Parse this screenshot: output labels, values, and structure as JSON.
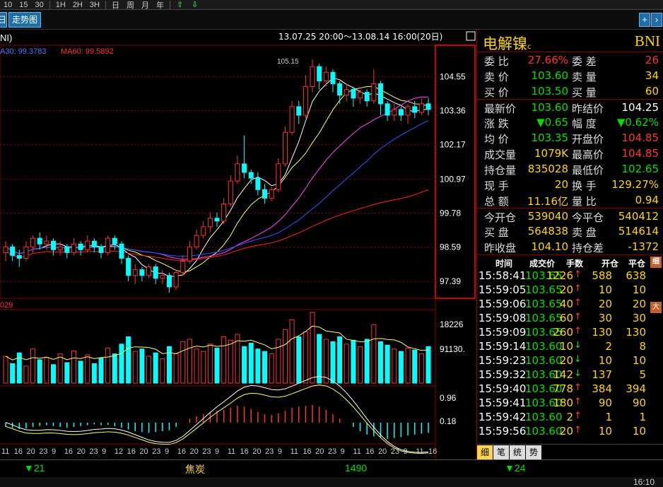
{
  "toolbar": {
    "periods": [
      "10",
      "15",
      "30",
      "1H",
      "2H",
      "3H",
      "日",
      "周",
      "月",
      "年"
    ],
    "up_arrow": "⇧",
    "down_arrow": "⇩"
  },
  "tabs": {
    "left_partial": "日",
    "trend": "走势图",
    "plus": "+",
    "right": "›"
  },
  "chart": {
    "code_tag": "NI)",
    "date_range": "13.07.25 20:00～13.08.14 16:00(20日)",
    "ma30_label": "A30: 99.3783",
    "ma60_label": "MA60: 99.5892",
    "peak_label": "105.15",
    "price_ticks": [
      "104.55",
      "103.36",
      "102.17",
      "100.97",
      "99.78",
      "98.59",
      "97.39"
    ],
    "vol_label": "029",
    "vol_ticks": [
      "18226",
      "91130."
    ],
    "macd_ticks": [
      "0.96",
      "0.18"
    ],
    "x_labels": [
      "11",
      "16",
      "20",
      "23",
      "9",
      "16",
      "20",
      "23",
      "9",
      "12",
      "16",
      "20",
      "23",
      "9",
      "16",
      "20",
      "23",
      "9",
      "11",
      "16",
      "20",
      "23",
      "9",
      "11",
      "16",
      "20",
      "23",
      "9",
      "11",
      "16",
      "20",
      "23",
      "9",
      "11",
      "16"
    ],
    "colors": {
      "up": "#ff3232",
      "down": "#00ffff",
      "ma5": "#ffffff",
      "ma10": "#ffff66",
      "ma20": "#ff44ff",
      "ma30": "#3355ff",
      "ma60": "#ff2222"
    }
  },
  "chart_data": {
    "type": "candlestick",
    "title": "",
    "ylim": [
      97.0,
      105.3
    ],
    "y_ticks": [
      104.55,
      103.36,
      102.17,
      100.97,
      99.78,
      98.59,
      97.39
    ],
    "peak_marker": 105.15,
    "series": [
      {
        "name": "MA30",
        "last": 99.3783
      },
      {
        "name": "MA60",
        "last": 99.5892
      }
    ],
    "candles": [
      [
        98.4,
        98.6,
        98.1,
        98.8
      ],
      [
        98.6,
        98.3,
        98.1,
        98.7
      ],
      [
        98.3,
        98.2,
        97.9,
        98.5
      ],
      [
        98.2,
        98.6,
        98.1,
        98.8
      ],
      [
        98.6,
        98.9,
        98.4,
        99.0
      ],
      [
        98.9,
        98.7,
        98.5,
        99.1
      ],
      [
        98.7,
        98.8,
        98.5,
        99.0
      ],
      [
        98.8,
        98.5,
        98.3,
        98.9
      ],
      [
        98.5,
        98.6,
        98.3,
        98.8
      ],
      [
        98.6,
        98.4,
        98.2,
        98.7
      ],
      [
        98.4,
        98.7,
        98.3,
        98.9
      ],
      [
        98.7,
        98.5,
        98.3,
        98.8
      ],
      [
        98.5,
        98.8,
        98.4,
        99.0
      ],
      [
        98.8,
        98.6,
        98.4,
        98.9
      ],
      [
        98.6,
        98.4,
        98.2,
        98.7
      ],
      [
        98.4,
        98.9,
        98.3,
        99.0
      ],
      [
        98.9,
        98.7,
        98.5,
        99.0
      ],
      [
        98.7,
        98.2,
        98.0,
        98.8
      ],
      [
        98.2,
        97.6,
        97.4,
        98.3
      ],
      [
        97.6,
        97.8,
        97.3,
        98.0
      ],
      [
        97.8,
        97.6,
        97.4,
        97.9
      ],
      [
        97.6,
        97.9,
        97.5,
        98.0
      ],
      [
        97.9,
        97.5,
        97.3,
        98.0
      ],
      [
        97.5,
        97.6,
        97.3,
        97.8
      ],
      [
        97.6,
        97.2,
        97.0,
        97.7
      ],
      [
        97.2,
        97.7,
        97.1,
        97.8
      ],
      [
        97.7,
        98.1,
        97.6,
        98.3
      ],
      [
        98.1,
        98.6,
        98.0,
        98.8
      ],
      [
        98.6,
        99.0,
        98.5,
        99.2
      ],
      [
        99.0,
        99.3,
        98.9,
        99.5
      ],
      [
        99.3,
        99.6,
        99.1,
        99.8
      ],
      [
        99.6,
        99.5,
        99.3,
        99.8
      ],
      [
        99.5,
        100.1,
        99.4,
        100.3
      ],
      [
        100.1,
        100.9,
        100.0,
        101.1
      ],
      [
        100.9,
        101.5,
        100.8,
        101.8
      ],
      [
        101.5,
        101.2,
        101.0,
        102.5
      ],
      [
        101.2,
        101.0,
        100.8,
        101.3
      ],
      [
        101.0,
        100.6,
        100.4,
        101.2
      ],
      [
        100.6,
        100.3,
        100.1,
        100.8
      ],
      [
        100.3,
        100.6,
        100.2,
        100.7
      ],
      [
        100.6,
        101.5,
        100.5,
        101.7
      ],
      [
        101.5,
        102.6,
        101.4,
        102.8
      ],
      [
        102.6,
        103.5,
        102.5,
        103.7
      ],
      [
        103.5,
        103.2,
        102.9,
        103.7
      ],
      [
        103.2,
        104.2,
        103.1,
        104.6
      ],
      [
        104.2,
        104.9,
        104.0,
        105.15
      ],
      [
        104.9,
        104.4,
        104.1,
        105.0
      ],
      [
        104.4,
        104.7,
        104.2,
        104.9
      ],
      [
        104.7,
        104.3,
        104.0,
        104.8
      ],
      [
        104.3,
        103.9,
        103.6,
        104.4
      ],
      [
        103.9,
        104.1,
        103.7,
        104.3
      ],
      [
        104.1,
        103.8,
        103.5,
        104.2
      ],
      [
        103.8,
        104.0,
        103.6,
        104.1
      ],
      [
        104.0,
        103.7,
        103.5,
        104.1
      ],
      [
        103.7,
        104.3,
        103.6,
        104.8
      ],
      [
        104.3,
        103.6,
        103.2,
        104.4
      ],
      [
        103.6,
        103.2,
        103.0,
        103.7
      ],
      [
        103.2,
        103.4,
        103.0,
        103.6
      ],
      [
        103.4,
        103.2,
        103.0,
        103.5
      ],
      [
        103.2,
        103.5,
        102.9,
        103.6
      ],
      [
        103.5,
        103.3,
        103.1,
        103.7
      ],
      [
        103.3,
        103.6,
        103.2,
        103.8
      ],
      [
        103.6,
        103.4,
        103.2,
        103.8
      ]
    ],
    "volumes": [
      55,
      40,
      62,
      35,
      70,
      48,
      52,
      38,
      60,
      42,
      66,
      45,
      58,
      40,
      52,
      72,
      60,
      80,
      95,
      65,
      70,
      55,
      62,
      50,
      75,
      60,
      85,
      90,
      70,
      65,
      80,
      72,
      95,
      88,
      100,
      75,
      82,
      70,
      65,
      60,
      90,
      110,
      130,
      95,
      105,
      145,
      100,
      90,
      85,
      95,
      80,
      88,
      75,
      90,
      120,
      85,
      78,
      70,
      65,
      72,
      68,
      60,
      75
    ],
    "macd_hist": [
      -0.1,
      -0.12,
      -0.15,
      -0.14,
      -0.1,
      -0.08,
      -0.06,
      -0.08,
      -0.1,
      -0.12,
      -0.1,
      -0.08,
      -0.06,
      -0.04,
      -0.06,
      -0.05,
      -0.08,
      -0.12,
      -0.16,
      -0.2,
      -0.22,
      -0.24,
      -0.22,
      -0.2,
      -0.18,
      -0.1,
      0.0,
      0.1,
      0.15,
      0.2,
      0.25,
      0.28,
      0.3,
      0.35,
      0.4,
      0.38,
      0.32,
      0.25,
      0.2,
      0.18,
      0.22,
      0.28,
      0.35,
      0.38,
      0.4,
      0.42,
      0.38,
      0.3,
      0.2,
      0.1,
      0.0,
      -0.1,
      -0.2,
      -0.28,
      -0.32,
      -0.36,
      -0.38,
      -0.36,
      -0.34,
      -0.3,
      -0.28,
      -0.26,
      -0.24
    ]
  },
  "panel": {
    "name": "电解镍",
    "name_suffix": "c",
    "code": "BNI",
    "rows": [
      {
        "l1": "委  比",
        "v1": "27.66%",
        "c1": "r",
        "l2": "委  差",
        "v2": "26",
        "c2": "r"
      },
      {
        "l1": "卖  价",
        "v1": "103.60",
        "c1": "g",
        "l2": "卖  量",
        "v2": "34",
        "c2": "y"
      },
      {
        "l1": "买  价",
        "v1": "103.50",
        "c1": "g",
        "l2": "买  量",
        "v2": "60",
        "c2": "y"
      },
      {
        "l1": "最新价",
        "v1": "103.60",
        "c1": "g",
        "l2": "昨结价",
        "v2": "104.25",
        "c2": "w"
      },
      {
        "l1": "涨  跌",
        "v1": "▼0.65",
        "c1": "g",
        "l2": "幅  度",
        "v2": "▼0.62%",
        "c2": "g"
      },
      {
        "l1": "均  价",
        "v1": "103.35",
        "c1": "g",
        "l2": "开盘价",
        "v2": "104.85",
        "c2": "r"
      },
      {
        "l1": "成交量",
        "v1": "1079K",
        "c1": "y",
        "l2": "最高价",
        "v2": "104.85",
        "c2": "r"
      },
      {
        "l1": "持仓量",
        "v1": "835028",
        "c1": "y",
        "l2": "最低价",
        "v2": "102.65",
        "c2": "g"
      },
      {
        "l1": "现  手",
        "v1": "20",
        "c1": "y",
        "l2": "换  手",
        "v2": "129.27%",
        "c2": "y"
      },
      {
        "l1": "总  额",
        "v1": "11.16亿",
        "c1": "y",
        "l2": "量  比",
        "v2": "0.94",
        "c2": "y"
      },
      {
        "l1": "今开仓",
        "v1": "539040",
        "c1": "y",
        "l2": "今平仓",
        "v2": "540412",
        "c2": "y"
      },
      {
        "l1": "买  盘",
        "v1": "564838",
        "c1": "y",
        "l2": "卖  盘",
        "v2": "514614",
        "c2": "y"
      },
      {
        "l1": "昨收盘",
        "v1": "104.10",
        "c1": "y",
        "l2": "持仓差",
        "v2": "-1372",
        "c2": "y"
      }
    ],
    "ticks_header": {
      "time": "时间",
      "price": "成交价",
      "vol": "手数",
      "open": "开仓",
      "close": "平仓"
    },
    "ticks": [
      {
        "t": "15:58:41",
        "p": "103.65",
        "v": "1226",
        "a": "↑",
        "o": "588",
        "c": "638"
      },
      {
        "t": "15:59:05",
        "p": "103.65",
        "v": "20",
        "a": "↑",
        "o": "10",
        "c": "10"
      },
      {
        "t": "15:59:06",
        "p": "103.65",
        "v": "40",
        "a": "↑",
        "o": "20",
        "c": "20"
      },
      {
        "t": "15:59:08",
        "p": "103.65",
        "v": "60",
        "a": "↑",
        "o": "30",
        "c": "30"
      },
      {
        "t": "15:59:09",
        "p": "103.65",
        "v": "260",
        "a": "↑",
        "o": "130",
        "c": "130"
      },
      {
        "t": "15:59:14",
        "p": "103.60",
        "v": "10",
        "a": "↓",
        "o": "2",
        "c": "8"
      },
      {
        "t": "15:59:23",
        "p": "103.60",
        "v": "20",
        "a": "↓",
        "o": "10",
        "c": "10"
      },
      {
        "t": "15:59:32",
        "p": "103.60",
        "v": "142",
        "a": "↓",
        "o": "137",
        "c": "5"
      },
      {
        "t": "15:59:40",
        "p": "103.60",
        "v": "778",
        "a": "↑",
        "o": "384",
        "c": "394"
      },
      {
        "t": "15:59:41",
        "p": "103.60",
        "v": "180",
        "a": "↑",
        "o": "90",
        "c": "90"
      },
      {
        "t": "15:59:42",
        "p": "103.60",
        "v": "2",
        "a": "↑",
        "o": "1",
        "c": "1"
      },
      {
        "t": "15:59:56",
        "p": "103.60",
        "v": "20",
        "a": "↑",
        "o": "10",
        "c": "10"
      }
    ],
    "side_btns": [
      "细",
      "大"
    ],
    "bottom_tabs": [
      "细",
      "笔",
      "统",
      "势"
    ]
  },
  "status": {
    "s1": "▼21",
    "s2": "焦炭",
    "s3": "1490",
    "s4": "▼24",
    "clock": "16:10"
  }
}
